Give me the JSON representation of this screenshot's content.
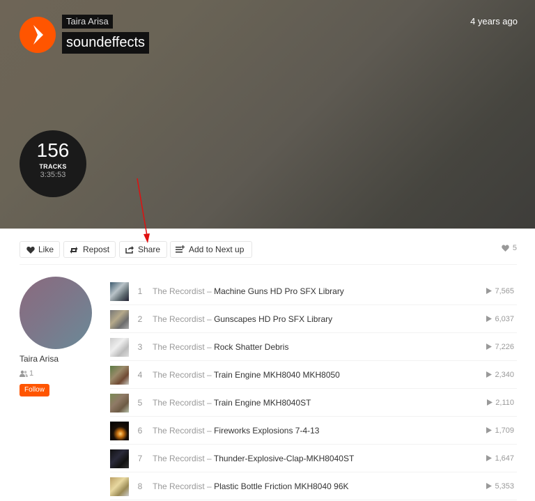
{
  "header": {
    "user": "Taira Arisa",
    "title": "soundeffects",
    "time_ago": "4 years ago",
    "track_count": "156",
    "tracks_label": "TRACKS",
    "duration": "3:35:53"
  },
  "actions": {
    "like": "Like",
    "repost": "Repost",
    "share": "Share",
    "add_next": "Add to Next up",
    "likes_count": "5"
  },
  "owner": {
    "name": "Taira Arisa",
    "followers": "1",
    "follow_label": "Follow"
  },
  "tracks": [
    {
      "num": "1",
      "artist": "The Recordist",
      "title": "Machine Guns HD Pro SFX Library",
      "plays": "7,565"
    },
    {
      "num": "2",
      "artist": "The Recordist",
      "title": "Gunscapes HD Pro SFX Library",
      "plays": "6,037"
    },
    {
      "num": "3",
      "artist": "The Recordist",
      "title": "Rock Shatter Debris",
      "plays": "7,226"
    },
    {
      "num": "4",
      "artist": "The Recordist",
      "title": "Train Engine MKH8040 MKH8050",
      "plays": "2,340"
    },
    {
      "num": "5",
      "artist": "The Recordist",
      "title": "Train Engine MKH8040ST",
      "plays": "2,110"
    },
    {
      "num": "6",
      "artist": "The Recordist",
      "title": "Fireworks Explosions 7-4-13",
      "plays": "1,709"
    },
    {
      "num": "7",
      "artist": "The Recordist",
      "title": "Thunder-Explosive-Clap-MKH8040ST",
      "plays": "1,647"
    },
    {
      "num": "8",
      "artist": "The Recordist",
      "title": "Plastic Bottle Friction MKH8040 96K",
      "plays": "5,353"
    }
  ],
  "separator": "–",
  "colors": {
    "accent": "#ff5500"
  },
  "icons": {
    "play": "play-icon",
    "like": "heart-icon",
    "repost": "repost-icon",
    "share": "share-icon",
    "add_next": "add-to-queue-icon",
    "followers": "followers-icon",
    "plays": "play-count-icon"
  }
}
